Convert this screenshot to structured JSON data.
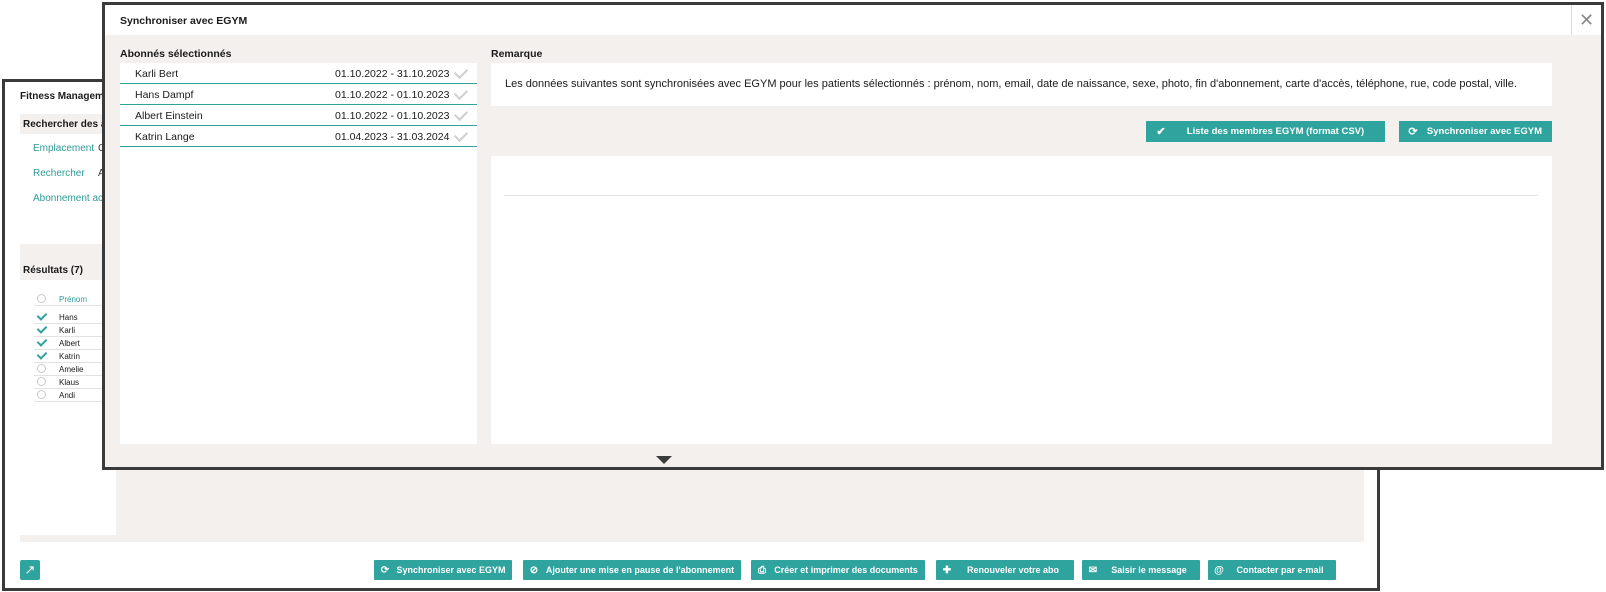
{
  "background": {
    "window_title": "Fitness Management",
    "search_section_title": "Rechercher des abonnés",
    "filters": [
      {
        "label": "Emplacement",
        "value": "C"
      },
      {
        "label": "Rechercher",
        "value": "A"
      },
      {
        "label": "Abonnement actif",
        "value": ""
      }
    ],
    "results_title": "Résultats (7)",
    "column_header": "Prénom",
    "rows": [
      {
        "name": "Hans",
        "checked": true
      },
      {
        "name": "Karli",
        "checked": true
      },
      {
        "name": "Albert",
        "checked": true
      },
      {
        "name": "Katrin",
        "checked": true
      },
      {
        "name": "Amelie",
        "checked": false
      },
      {
        "name": "Klaus",
        "checked": false
      },
      {
        "name": "Andi",
        "checked": false
      }
    ],
    "footer_icon": "share-icon",
    "actions": [
      {
        "label": "Synchroniser avec EGYM",
        "icon": "sync-icon"
      },
      {
        "label": "Ajouter une mise en pause de l'abonnement",
        "icon": "pause-circle-icon"
      },
      {
        "label": "Créer et imprimer des documents",
        "icon": "printer-icon"
      },
      {
        "label": "Renouveler votre abo",
        "icon": "plus-icon"
      },
      {
        "label": "Saisir le message",
        "icon": "envelope-icon"
      },
      {
        "label": "Contacter par e-mail",
        "icon": "at-icon"
      }
    ]
  },
  "modal": {
    "title": "Synchroniser avec EGYM",
    "close_label": "✕",
    "selected_title": "Abonnés sélectionnés",
    "members": [
      {
        "name": "Karli Bert",
        "period": "01.10.2022 - 31.10.2023"
      },
      {
        "name": "Hans Dampf",
        "period": "01.10.2022 - 01.10.2023"
      },
      {
        "name": "Albert Einstein",
        "period": "01.10.2022 - 01.10.2023"
      },
      {
        "name": "Katrin Lange",
        "period": "01.04.2023 - 31.03.2024"
      }
    ],
    "remark_title": "Remarque",
    "remark_text": "Les données suivantes sont synchronisées avec EGYM pour les patients sélectionnés : prénom, nom, email, date de naissance, sexe, photo, fin d'abonnement, carte d'accès, téléphone, rue, code postal, ville.",
    "csv_button": "Liste des membres EGYM (format CSV)",
    "sync_button": "Synchroniser avec EGYM"
  },
  "colors": {
    "accent": "#2fa39e",
    "panel_bg": "#f3f0ed",
    "border": "#3a3a3a"
  }
}
